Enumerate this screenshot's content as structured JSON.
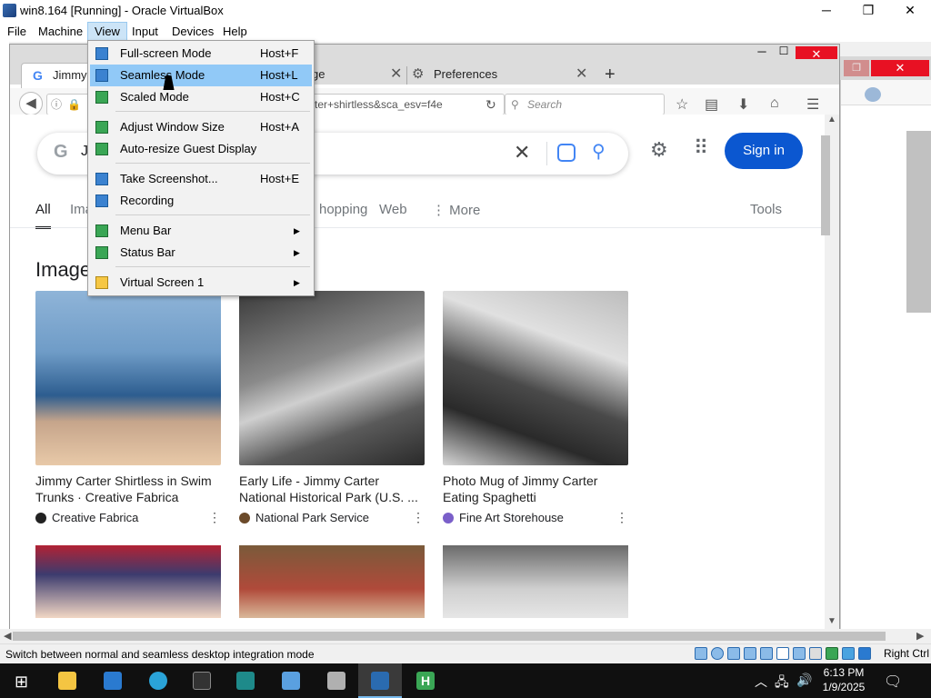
{
  "window": {
    "title": "win8.164 [Running] - Oracle VirtualBox"
  },
  "menubar": [
    "File",
    "Machine",
    "View",
    "Input",
    "Devices",
    "Help"
  ],
  "view_menu": {
    "items": [
      {
        "label": "Full-screen Mode",
        "shortcut": "Host+F",
        "icon": "fullscreen-icon"
      },
      {
        "label": "Seamless Mode",
        "shortcut": "Host+L",
        "icon": "seamless-icon",
        "highlighted": true
      },
      {
        "label": "Scaled Mode",
        "shortcut": "Host+C",
        "icon": "scaled-icon"
      },
      {
        "label": "Adjust Window Size",
        "shortcut": "Host+A",
        "icon": "adjust-window-icon"
      },
      {
        "label": "Auto-resize Guest Display",
        "shortcut": "",
        "icon": "auto-resize-icon"
      },
      {
        "label": "Take Screenshot...",
        "shortcut": "Host+E",
        "icon": "screenshot-icon"
      },
      {
        "label": "Recording",
        "shortcut": "",
        "icon": "recording-icon"
      },
      {
        "label": "Menu Bar",
        "shortcut": "",
        "icon": "menu-bar-icon"
      },
      {
        "label": "Status Bar",
        "shortcut": "",
        "icon": "status-bar-icon"
      },
      {
        "label": "Virtual Screen 1",
        "shortcut": "",
        "icon": "virtual-screen-icon"
      }
    ]
  },
  "browser": {
    "tabs": [
      {
        "label": "Jimmy",
        "icon": "google-icon"
      },
      {
        "label": "ge",
        "icon": ""
      },
      {
        "label": "Preferences",
        "icon": "gear-icon"
      }
    ],
    "url_fragment": "rter+shirtless&sca_esv=f4e",
    "search_placeholder": "Search"
  },
  "google": {
    "query_start": "J",
    "signin": "Sign in",
    "tabs": [
      "All",
      "Ima",
      "hopping",
      "Web",
      "More",
      "Tools"
    ],
    "images_heading": "Image",
    "results": [
      {
        "title": "Jimmy Carter Shirtless in Swim Trunks · Creative Fabrica",
        "source": "Creative Fabrica"
      },
      {
        "title": "Early Life - Jimmy Carter National Historical Park (U.S. ...",
        "source": "National Park Service"
      },
      {
        "title": "Photo Mug of Jimmy Carter Eating Spaghetti",
        "source": "Fine Art Storehouse"
      }
    ]
  },
  "statusbar": {
    "text": "Switch between normal and seamless desktop integration mode",
    "hostkey": "Right Ctrl"
  },
  "taskbar": {
    "time": "6:13 PM",
    "date": "1/9/2025"
  }
}
